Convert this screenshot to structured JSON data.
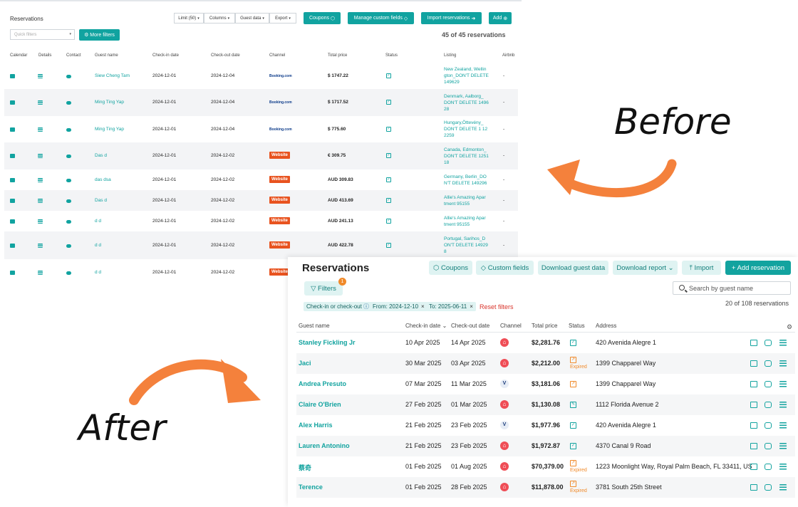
{
  "before": {
    "title": "Reservations",
    "toolbar": [
      {
        "label": "Limit (50)",
        "caret": "▾"
      },
      {
        "label": "Columns",
        "caret": "▾"
      },
      {
        "label": "Guest data",
        "caret": "▾"
      },
      {
        "label": "Export",
        "caret": "▾"
      }
    ],
    "buttons": {
      "coupons": "Coupons",
      "custom_fields": "Manage custom fields",
      "import": "Import reservations",
      "add": "Add"
    },
    "quick_filters_placeholder": "Quick filters",
    "more_filters": "More filters",
    "count": "45 of 45 reservations",
    "columns": [
      "Calendar",
      "Details",
      "Contact",
      "Guest name",
      "Check-in date",
      "Check-out date",
      "Channel",
      "Total price",
      "Status",
      "Listing",
      "Airbnb"
    ],
    "rows": [
      {
        "guest": "Siew Cheng Tam",
        "checkin": "2024-12-01",
        "checkout": "2024-12-04",
        "channel": "Booking.com",
        "price": "$ 1747.22",
        "listing": [
          "New Zealand, Wellin",
          "gton_DON'T DELETE",
          "149629"
        ],
        "airbnb": "-"
      },
      {
        "guest": "Ming Ting Yap",
        "checkin": "2024-12-01",
        "checkout": "2024-12-04",
        "channel": "Booking.com",
        "price": "$ 1717.52",
        "listing": [
          "Denmark, Aalborg_",
          "DON'T DELETE 1496",
          "28"
        ],
        "airbnb": "-"
      },
      {
        "guest": "Ming Ting Yap",
        "checkin": "2024-12-01",
        "checkout": "2024-12-04",
        "channel": "Booking.com",
        "price": "$ 775.60",
        "listing": [
          "Hungary,Öttevény_",
          "DON'T DELETE 1 12",
          "2259"
        ],
        "airbnb": "-"
      },
      {
        "guest": "Das d",
        "checkin": "2024-12-01",
        "checkout": "2024-12-02",
        "channel": "Website",
        "price": "€ 309.75",
        "listing": [
          "Canada, Edmonton_",
          "DON'T DELETE 1251",
          "18"
        ],
        "airbnb": "-"
      },
      {
        "guest": "das dsa",
        "checkin": "2024-12-01",
        "checkout": "2024-12-02",
        "channel": "Website",
        "price": "AUD 309.83",
        "listing": [
          "Germany, Berlin_DO",
          "N'T DELETE 149296"
        ],
        "airbnb": "-"
      },
      {
        "guest": "Das d",
        "checkin": "2024-12-01",
        "checkout": "2024-12-02",
        "channel": "Website",
        "price": "AUD 413.69",
        "listing": [
          "Allie's Amazing Apar",
          "tment 95155"
        ],
        "airbnb": "-"
      },
      {
        "guest": "d d",
        "checkin": "2024-12-01",
        "checkout": "2024-12-02",
        "channel": "Website",
        "price": "AUD 241.13",
        "listing": [
          "Allie's Amazing Apar",
          "tment 95155"
        ],
        "airbnb": "-"
      },
      {
        "guest": "d d",
        "checkin": "2024-12-01",
        "checkout": "2024-12-02",
        "channel": "Website",
        "price": "AUD 422.78",
        "listing": [
          "Portugal, Sarihos_D",
          "ON'T DELETE 14929",
          "8"
        ],
        "airbnb": "-"
      },
      {
        "guest": "d d",
        "checkin": "2024-12-01",
        "checkout": "2024-12-02",
        "channel": "Website",
        "price": "",
        "listing": [],
        "airbnb": ""
      }
    ]
  },
  "labels": {
    "before": "Before",
    "after": "After"
  },
  "colors": {
    "accent": "#12a39f",
    "arrow": "#f4813c",
    "website": "#e8531f",
    "airbnb": "#ef4d56",
    "expired": "#f08a2a",
    "reset": "#d9342b"
  },
  "after": {
    "title": "Reservations",
    "buttons": {
      "coupons": "Coupons",
      "custom_fields": "Custom fields",
      "download_guest": "Download guest data",
      "download_report": "Download report",
      "import": "Import",
      "add": "+ Add reservation"
    },
    "filters": "Filters",
    "filter_badge": "1",
    "search_placeholder": "Search by guest name",
    "chips": [
      "Check-in or check-out",
      "From: 2024-12-10",
      "To: 2025-06-11"
    ],
    "reset_filters": "Reset filters",
    "count": "20 of 108 reservations",
    "columns": [
      "Guest name",
      "Check-in date",
      "Check-out date",
      "Channel",
      "Total price",
      "Status",
      "Address"
    ],
    "expired_label": "Expired",
    "rows": [
      {
        "guest": "Stanley Fickling Jr",
        "checkin": "10 Apr 2025",
        "checkout": "14 Apr 2025",
        "channel": "airbnb",
        "price": "$2,281.76",
        "status": "confirmed",
        "address": "420 Avenida Alegre 1"
      },
      {
        "guest": "Jaci",
        "checkin": "30 Mar 2025",
        "checkout": "03 Apr 2025",
        "channel": "airbnb",
        "price": "$2,212.00",
        "status": "expired",
        "address": "1399 Chapparel Way"
      },
      {
        "guest": "Andrea Presuto",
        "checkin": "07 Mar 2025",
        "checkout": "11 Mar 2025",
        "channel": "vrbo",
        "price": "$3,181.06",
        "status": "pending",
        "address": "1399 Chapparel Way"
      },
      {
        "guest": "Claire O'Brien",
        "checkin": "27 Feb 2025",
        "checkout": "01 Mar 2025",
        "channel": "airbnb",
        "price": "$1,130.08",
        "status": "edited",
        "address": "1112 Florida Avenue 2"
      },
      {
        "guest": "Alex Harris",
        "checkin": "21 Feb 2025",
        "checkout": "23 Feb 2025",
        "channel": "vrbo",
        "price": "$1,977.96",
        "status": "confirmed",
        "address": "420 Avenida Alegre 1"
      },
      {
        "guest": "Lauren Antonino",
        "checkin": "21 Feb 2025",
        "checkout": "23 Feb 2025",
        "channel": "airbnb",
        "price": "$1,972.87",
        "status": "confirmed",
        "address": "4370 Canal 9 Road"
      },
      {
        "guest": "蔡奇",
        "checkin": "01 Feb 2025",
        "checkout": "01 Aug 2025",
        "channel": "airbnb",
        "price": "$70,379.00",
        "status": "expired",
        "address": "1223 Moonlight Way, Royal Palm Beach, FL 33411, US"
      },
      {
        "guest": "Terence",
        "checkin": "01 Feb 2025",
        "checkout": "28 Feb 2025",
        "channel": "airbnb",
        "price": "$11,878.00",
        "status": "expired",
        "address": "3781 South 25th Street"
      }
    ]
  }
}
